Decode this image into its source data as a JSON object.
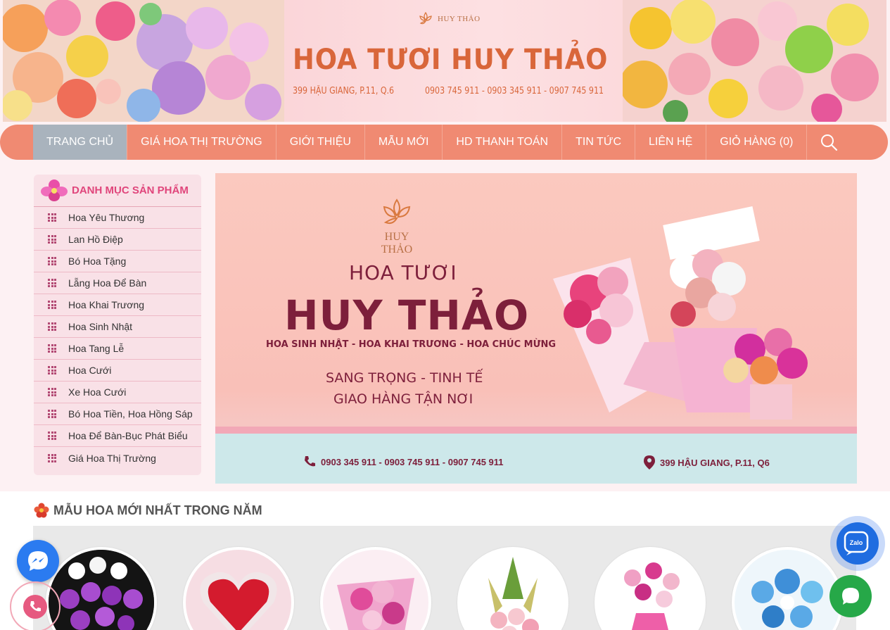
{
  "header": {
    "logo_small": "HUY THẢO",
    "title": "HOA TƯƠI HUY THẢO",
    "address": "399 HẬU GIANG, P.11, Q.6",
    "phones": "0903 745 911 - 0903 345 911 - 0907 745 911"
  },
  "nav": {
    "items": [
      "TRANG CHỦ",
      "GIÁ HOA THỊ TRƯỜNG",
      "GIỚI THIỆU",
      "MẪU MỚI",
      "HD THANH TOÁN",
      "TIN TỨC",
      "LIÊN HỆ",
      "GIỎ HÀNG  (0)"
    ],
    "active": "TRANG CHỦ",
    "search_icon": "search-icon",
    "color": "#f08a72"
  },
  "sidebar": {
    "title": "DANH MỤC SẢN PHẨM",
    "items": [
      "Hoa Yêu Thương",
      "Lan Hồ Điệp",
      "Bó Hoa Tặng",
      "Lẵng Hoa Để Bàn",
      "Hoa Khai Trương",
      "Hoa Sinh Nhật",
      "Hoa Tang Lễ",
      "Hoa Cưới",
      "Xe Hoa Cưới",
      "Bó Hoa Tiền, Hoa Hồng Sáp",
      "Hoa Để Bàn-Bục Phát Biểu",
      "Giá Hoa Thị Trường"
    ]
  },
  "hero": {
    "logo_line1": "HUY",
    "logo_line2": "THẢO",
    "line1": "HOA TƯƠI",
    "line2": "HUY THẢO",
    "line3": "HOA SINH NHẬT - HOA KHAI TRƯƠNG - HOA CHÚC MỪNG",
    "line4": "SANG TRỌNG - TINH TẾ",
    "line5": "GIAO HÀNG TẬN NƠI",
    "phones": "0903 345 911 - 0903 745 911 - 0907 745 911",
    "address": "399 HẬU GIANG, P.11, Q6"
  },
  "section": {
    "title": "MẪU HOA MỚI NHẤT TRONG NĂM"
  },
  "floating": {
    "zalo_label": "Zalo"
  }
}
